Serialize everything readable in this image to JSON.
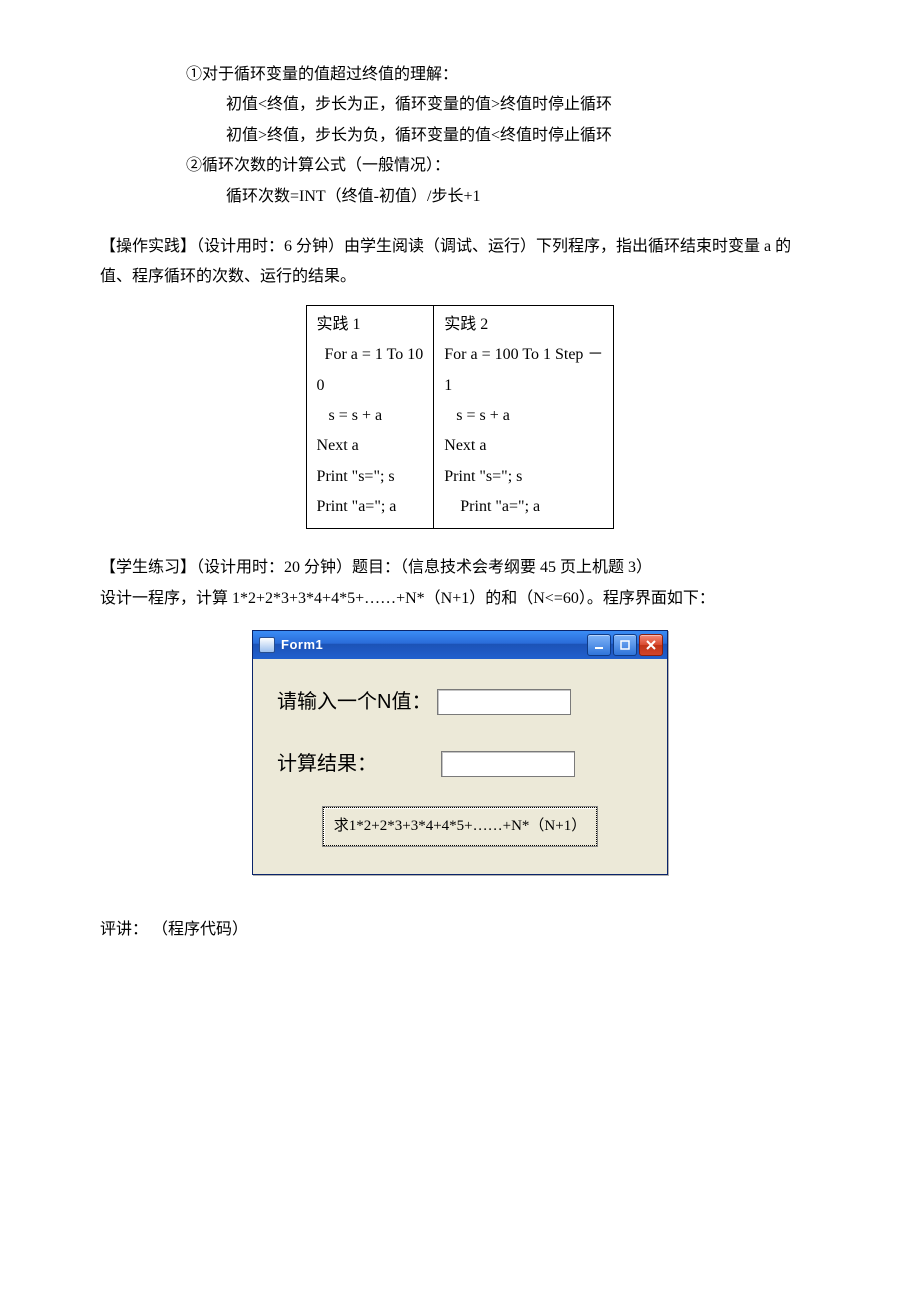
{
  "notes": {
    "pt1_header": "①对于循环变量的值超过终值的理解：",
    "pt1_line1": "初值<终值，步长为正，循环变量的值>终值时停止循环",
    "pt1_line2": "初值>终值，步长为负，循环变量的值<终值时停止循环",
    "pt2_header": "②循环次数的计算公式（一般情况）：",
    "pt2_line1": "循环次数=INT（终值-初值）/步长+1"
  },
  "practice_intro": "【操作实践】（设计用时：6 分钟）由学生阅读（调试、运行）下列程序，指出循环结束时变量 a 的值、程序循环的次数、运行的结果。",
  "practice": {
    "col1": {
      "title": "实践 1",
      "l1": "  For a = 1 To 10",
      "l2": "0",
      "l3": "   s = s + a",
      "l4": "Next a",
      "l5": "Print \"s=\"; s",
      "l6": "Print \"a=\"; a"
    },
    "col2": {
      "title": "实践 2",
      "l1": "For a = 100 To 1 Step －",
      "l2": "1",
      "l3": "   s = s + a",
      "l4": "Next a",
      "l5": "Print \"s=\"; s",
      "l6": "    Print \"a=\"; a"
    }
  },
  "exercise_intro_1": "【学生练习】（设计用时：20 分钟）题目：（信息技术会考纲要 45 页上机题 3）",
  "exercise_intro_2": "设计一程序，计算 1*2+2*3+3*4+4*5+……+N*（N+1）的和（N<=60）。程序界面如下：",
  "vbform": {
    "title": "Form1",
    "label_n": "请输入一个N值：",
    "label_result": "计算结果：",
    "button_caption": "求1*2+2*3+3*4+4*5+……+N*（N+1）"
  },
  "footer": "评讲：  （程序代码）"
}
